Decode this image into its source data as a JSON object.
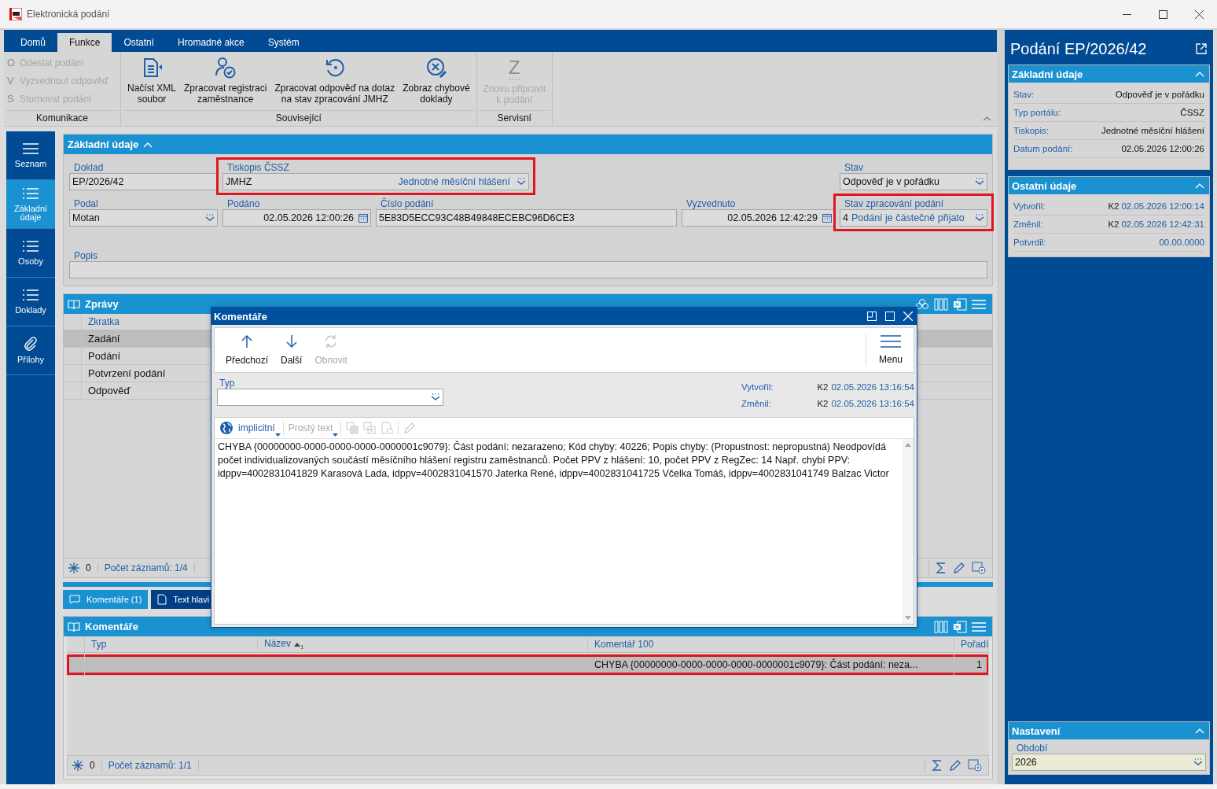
{
  "window": {
    "title": "Elektronická podání"
  },
  "ribbon": {
    "tabs": [
      {
        "label": "Domů",
        "selected": false
      },
      {
        "label": "Funkce",
        "selected": true
      },
      {
        "label": "Ostatní",
        "selected": false
      },
      {
        "label": "Hromadné akce",
        "selected": false
      },
      {
        "label": "Systém",
        "selected": false
      }
    ],
    "groups": [
      {
        "label": "Komunikace",
        "kind": "small",
        "buttons": [
          {
            "key": "O",
            "lines": [
              "Odeslat podání"
            ],
            "disabled": true
          },
          {
            "key": "V",
            "lines": [
              "Vyzvednout odpověď"
            ],
            "disabled": true
          },
          {
            "key": "S",
            "lines": [
              "Stornovat podání"
            ],
            "disabled": true
          }
        ]
      },
      {
        "label": "Související",
        "kind": "large",
        "buttons": [
          {
            "lines": [
              "Načíst XML",
              "soubor"
            ],
            "disabled": false
          },
          {
            "lines": [
              "Zpracovat registraci",
              "zaměstnance"
            ],
            "disabled": false
          },
          {
            "lines": [
              "Zpracovat odpověď na dotaz",
              "na stav zpracování JMHZ"
            ],
            "disabled": false
          },
          {
            "lines": [
              "Zobraz chybové",
              "doklady"
            ],
            "disabled": false
          }
        ]
      },
      {
        "label": "Servisní",
        "kind": "large",
        "buttons": [
          {
            "key": "Z",
            "lines": [
              "Znovu připravit",
              "k podání"
            ],
            "disabled": true
          }
        ]
      }
    ]
  },
  "nav": [
    {
      "label": "Seznam",
      "selected": false
    },
    {
      "label": "Základní údaje",
      "selected": true
    },
    {
      "label": "Osoby",
      "selected": false
    },
    {
      "label": "Doklady",
      "selected": false
    },
    {
      "label": "Přílohy",
      "selected": false
    }
  ],
  "form": {
    "title": "Základní údaje",
    "expanded": true,
    "fields": [
      {
        "label": "Doklad",
        "value": "EP/2026/42",
        "kind": "text"
      },
      {
        "label": "Tiskopis ČSSZ",
        "value": "JMHZ",
        "description": "Jednotné měsíční hlášení",
        "kind": "select",
        "highlighted": true
      },
      {
        "label": "Stav",
        "value": "Odpověď je v pořádku",
        "kind": "select"
      },
      {
        "label": "Podal",
        "value": "Motan",
        "kind": "select"
      },
      {
        "label": "Podáno",
        "value": "02.05.2026 12:00:26",
        "kind": "date"
      },
      {
        "label": "Číslo podání",
        "value": "5E83D5ECC93C48B49848ECEBC96D6CE3",
        "kind": "text"
      },
      {
        "label": "Vyzvednuto",
        "value": "02.05.2026 12:42:29",
        "kind": "date"
      },
      {
        "label": "Stav zpracování podání",
        "code": "4",
        "description": "Podání je částečně přijato",
        "kind": "select",
        "highlighted": true
      },
      {
        "label": "Popis",
        "kind": "text"
      }
    ]
  },
  "messages": {
    "title": "Zprávy",
    "columns": [
      "Zkratka"
    ],
    "rows": [
      {
        "cells": [
          "Zadání"
        ],
        "selected": true
      },
      {
        "cells": [
          "Podání"
        ],
        "selected": false
      },
      {
        "cells": [
          "Potvrzení podání"
        ],
        "selected": false
      },
      {
        "cells": [
          "Odpověď"
        ],
        "selected": false
      }
    ],
    "footer": {
      "filters": "0",
      "records": "Počet záznamů: 1/4"
    }
  },
  "detail_tabs": [
    {
      "label": "Komentáře (1)",
      "selected": true
    },
    {
      "label": "Text hlavi",
      "selected": false
    }
  ],
  "comments": {
    "title": "Komentáře",
    "columns": [
      {
        "label": "Typ"
      },
      {
        "label": "Název",
        "sorted_ascending": true,
        "sort_order": "1"
      },
      {
        "label": "Komentář 100"
      },
      {
        "label": "Pořadí"
      }
    ],
    "rows": [
      {
        "cells": [
          null,
          null,
          "CHYBA {00000000-0000-0000-0000-0000001c9079}: Část podání: neza...",
          "1"
        ],
        "selected": true,
        "highlighted": true
      }
    ],
    "footer": {
      "filters": "0",
      "records": "Počet záznamů: 1/1"
    }
  },
  "dialog": {
    "title": "Komentáře",
    "toolbar": [
      {
        "label": "Předchozí",
        "disabled": false
      },
      {
        "label": "Další",
        "disabled": false
      },
      {
        "label": "Obnovit",
        "disabled": true
      }
    ],
    "menu": "Menu",
    "type_label": "Typ",
    "meta": [
      {
        "label": "Vytvořil:",
        "user": "K2",
        "value": "02.05.2026 13:16:54"
      },
      {
        "label": "Změnil:",
        "user": "K2",
        "value": "02.05.2026 13:16:54"
      }
    ],
    "editor": {
      "language": "implicitní",
      "format": "Prostý text",
      "format_disabled": true,
      "text": "CHYBA {00000000-0000-0000-0000-0000001c9079}: Část podání: nezarazeno; Kód chyby: 40226; Popis chyby: (Propustnost: nepropustná) Neodpovídá počet individualizovaných součástí měsíčního hlášení registru zaměstnanců. Počet PPV z hlášení: 10, počet PPV z RegZec: 14 Např. chybí PPV: idppv=4002831041829 Karasová Lada, idppv=4002831041570 Jaterka René, idppv=4002831041725 Včelka Tomáš, idppv=4002831041749 Balzac Victor"
    }
  },
  "side": {
    "title": "Podání EP/2026/42",
    "sections": [
      {
        "title": "Základní údaje",
        "expanded": true,
        "rows": [
          {
            "label": "Stav:",
            "value": "Odpověď je v pořádku"
          },
          {
            "label": "Typ portálu:",
            "value": "ČSSZ"
          },
          {
            "label": "Tiskopis:",
            "value": "Jednotné měsíční hlášení"
          },
          {
            "label": "Datum podání:",
            "value": "02.05.2026 12:00:26"
          }
        ]
      },
      {
        "title": "Ostatní údaje",
        "expanded": true,
        "rows": [
          {
            "label": "Vytvořil:",
            "user": "K2",
            "value": "02.05.2026 12:00:14"
          },
          {
            "label": "Změnil:",
            "user": "K2",
            "value": "02.05.2026 12:42:31"
          },
          {
            "label": "Potvrdil:",
            "value": "00.00.0000"
          }
        ]
      }
    ],
    "settings": {
      "title": "Nastavení",
      "expanded": true,
      "field_label": "Období",
      "value": "2026"
    }
  }
}
